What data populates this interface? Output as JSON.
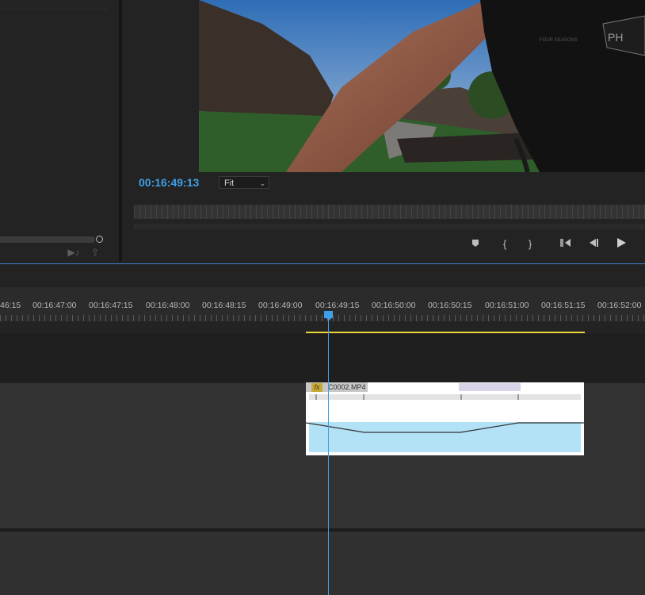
{
  "program": {
    "timecode": "00:16:49:13",
    "zoom_select": "Fit"
  },
  "transport": {
    "icons": [
      "add-marker-icon",
      "mark-in-icon",
      "mark-out-icon",
      "go-to-in-icon",
      "step-back-icon",
      "play-icon"
    ]
  },
  "source": {
    "icons": [
      "insert-icon",
      "export-frame-icon"
    ]
  },
  "timeline": {
    "ruler_labels": [
      "46:15",
      "00:16:47:00",
      "00:16:47:15",
      "00:16:48:00",
      "00:16:48:15",
      "00:16:49:00",
      "00:16:49:15",
      "00:16:50:00",
      "00:16:50:15",
      "00:16:51:00",
      "00:16:51:15",
      "00:16:52:00"
    ],
    "clip": {
      "name": "C0002.MP4",
      "fx_label": "fx"
    }
  },
  "colors": {
    "accent": "#3f9fe6",
    "work_area": "#e8d33a",
    "audio_clip": "#b3e2f7"
  }
}
